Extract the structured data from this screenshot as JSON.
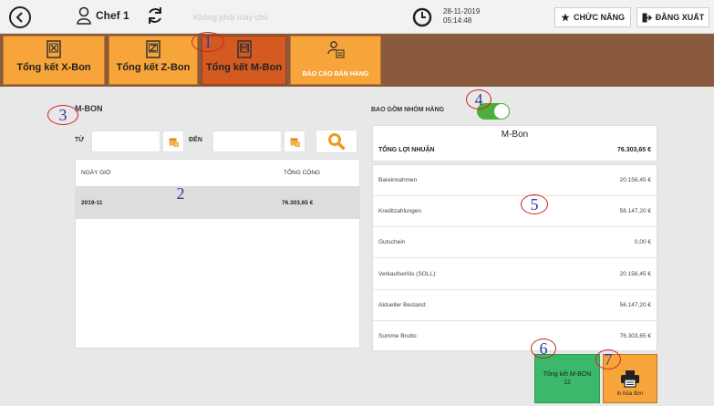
{
  "topbar": {
    "user": "Chef 1",
    "machine_note": "Không phải máy chủ",
    "date": "28-11-2019",
    "time": "05:14:48",
    "functions_label": "CHỨC NĂNG",
    "logout_label": "ĐĂNG XUẤT"
  },
  "toolbar": {
    "xbon_label": "Tổng kết X-Bon",
    "zbon_label": "Tổng kết Z-Bon",
    "mbon_label": "Tổng kết M-Bon",
    "report_label": "BÁO CÁO BÁN HÀNG"
  },
  "callouts": [
    "1",
    "2",
    "3",
    "4",
    "5",
    "6",
    "7"
  ],
  "left": {
    "title": "M-BON",
    "from_label": "TỪ",
    "from_value": "",
    "to_label": "ĐẾN",
    "to_value": "",
    "columns": [
      "NGÀY GIỜ",
      "TỔNG CỘNG"
    ],
    "rows": [
      {
        "date": "2019-11",
        "total": "76.303,65 €"
      }
    ]
  },
  "right": {
    "group_label": "BAO GỒM NHÓM HÀNG",
    "group_toggle_on": true,
    "summary_heading": "M-Bon",
    "profit_label": "TỔNG LỢI NHUẬN",
    "profit_value": "76.303,65 €",
    "details": [
      {
        "label": "Bareinnahmen",
        "value": "20.156,45 €"
      },
      {
        "label": "Kreditzahlungen",
        "value": "56.147,20 €"
      },
      {
        "label": "Gutschein",
        "value": "0,00 €"
      },
      {
        "label": "Verkaufserlös (SOLL):",
        "value": "20.156,45 €"
      },
      {
        "label": "Aktueller Bestand:",
        "value": "56.147,20 €"
      },
      {
        "label": "Summe Brutto:",
        "value": "76.303,65 €"
      }
    ],
    "mbon_button_label": "Tổng kết M-BON",
    "mbon_button_count": "12",
    "print_label": "In hóa đơn"
  },
  "colors": {
    "toolbar_bg": "#8a5a3e",
    "button_orange": "#f7a53a",
    "button_active": "#d45a22",
    "toggle_green": "#4caf3a",
    "mbon_green": "#3cb86a",
    "callout_red": "#d02020",
    "callout_number": "#2a3a9a"
  }
}
